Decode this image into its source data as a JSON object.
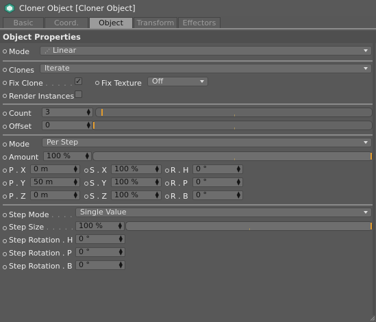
{
  "window": {
    "title": "Cloner Object [Cloner Object]"
  },
  "tabs": [
    "Basic",
    "Coord.",
    "Object",
    "Transform",
    "Effectors"
  ],
  "active_tab": "Object",
  "section": {
    "title": "Object Properties"
  },
  "mode": {
    "label": "Mode",
    "value": "Linear"
  },
  "clones": {
    "label": "Clones",
    "value": "Iterate"
  },
  "fix_clone": {
    "label": "Fix Clone",
    "checked": true
  },
  "fix_texture": {
    "label": "Fix Texture",
    "value": "Off"
  },
  "render_instances": {
    "label": "Render Instances",
    "checked": false
  },
  "count": {
    "label": "Count",
    "value": "3",
    "slider_fraction": 0.02
  },
  "offset": {
    "label": "Offset",
    "value": "0",
    "slider_fraction": 0.0
  },
  "mode2": {
    "label": "Mode",
    "value": "Per Step"
  },
  "amount": {
    "label": "Amount",
    "value": "100 %",
    "slider_fraction": 1.0
  },
  "transform": {
    "p_x": {
      "label": "P . X",
      "value": "0 m"
    },
    "p_y": {
      "label": "P . Y",
      "value": "50 m"
    },
    "p_z": {
      "label": "P . Z",
      "value": "0 m"
    },
    "s_x": {
      "label": "S . X",
      "value": "100 %"
    },
    "s_y": {
      "label": "S . Y",
      "value": "100 %"
    },
    "s_z": {
      "label": "S . Z",
      "value": "100 %"
    },
    "r_h": {
      "label": "R . H",
      "value": "0 °"
    },
    "r_p": {
      "label": "R . P",
      "value": "0 °"
    },
    "r_b": {
      "label": "R . B",
      "value": "0 °"
    }
  },
  "step_mode": {
    "label": "Step Mode",
    "value": "Single Value"
  },
  "step_size": {
    "label": "Step Size",
    "value": "100 %",
    "slider_fraction": 1.0
  },
  "step_rotation_h": {
    "label": "Step Rotation . H",
    "value": "0 °"
  },
  "step_rotation_p": {
    "label": "Step Rotation . P",
    "value": "0 °"
  },
  "step_rotation_b": {
    "label": "Step Rotation . B",
    "value": "0 °"
  },
  "colors": {
    "accent": "#e39c2e",
    "background": "#585858"
  }
}
